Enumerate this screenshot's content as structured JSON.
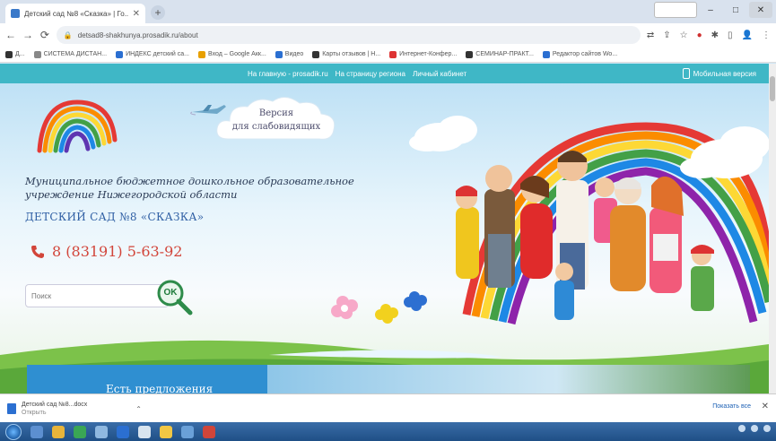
{
  "browser": {
    "tab_title": "Детский сад №8 «Сказка» | Го...",
    "new_tab_symbol": "+",
    "close_symbol": "✕",
    "address": "detsad8-shakhunya.prosadik.ru/about",
    "bookmarks": [
      "Д...",
      "СИСТЕМА ДИСТАН...",
      "ИНДЕКС детский са...",
      "Вход – Google Акк...",
      "Видео",
      "Карты отзывов | Н...",
      "Интернет-Конфер...",
      "СЕМИНАР-ПРАКТ...",
      "Редактор сайтов Wo..."
    ],
    "window_controls": {
      "minimize": "–",
      "maximize": "□",
      "close": "✕"
    }
  },
  "site": {
    "top_nav": {
      "links": [
        "На главную - prosadik.ru",
        "На страницу региона",
        "Личный кабинет"
      ],
      "mobile_label": "Мобильная версия"
    },
    "accessibility_button": {
      "line1": "Версия",
      "line2": "для слабовидящих"
    },
    "org_name": "Муниципальное бюджетное дошкольное образовательное учреждение Нижегородской области",
    "kindergarten_name": "ДЕТСКИЙ САД №8 «СКАЗКА»",
    "phone": "8 (83191) 5-63-92",
    "search": {
      "placeholder": "Поиск",
      "button_label": "OK"
    },
    "banner_text": "Есть предложения"
  },
  "downloads": {
    "file_name": "Детский сад №8...docx",
    "file_status": "Открыть",
    "show_all": "Показать все"
  },
  "colors": {
    "nav_bar": "#3fb7c6",
    "kg_name": "#2f5fa4",
    "phone": "#d2453a",
    "banner": "#2f8fd1"
  }
}
